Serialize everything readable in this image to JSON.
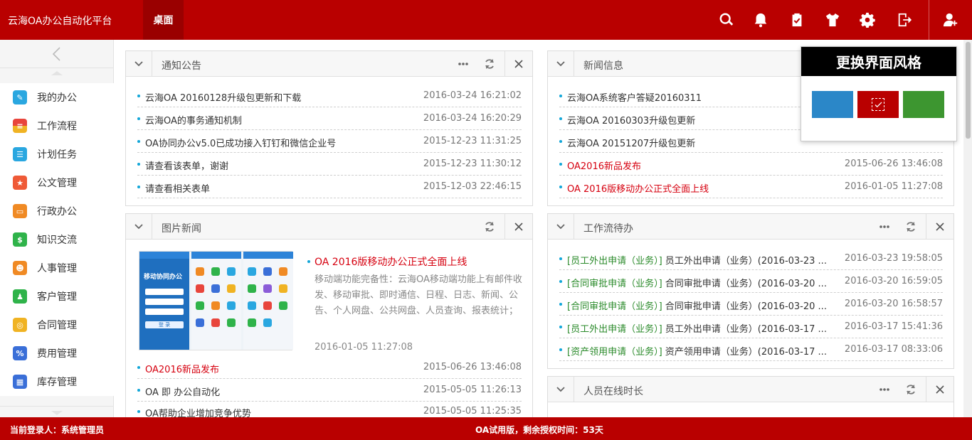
{
  "header": {
    "brand": "云海OA办公自动化平台",
    "active_tab": "桌面",
    "tools": [
      {
        "name": "search-icon"
      },
      {
        "name": "bell-icon"
      },
      {
        "name": "clipboard-check-icon"
      },
      {
        "name": "tshirt-icon"
      },
      {
        "name": "gear-icon"
      },
      {
        "name": "logout-icon"
      },
      {
        "name": "user-switch-icon"
      }
    ]
  },
  "sidebar": {
    "items": [
      {
        "label": "我的办公",
        "color": "#2aa7e0"
      },
      {
        "label": "工作流程",
        "color": "#e8453c"
      },
      {
        "label": "计划任务",
        "color": "#2aa7e0"
      },
      {
        "label": "公文管理",
        "color": "#ef5a37"
      },
      {
        "label": "行政办公",
        "color": "#f08a24"
      },
      {
        "label": "知识交流",
        "color": "#2fb34a"
      },
      {
        "label": "人事管理",
        "color": "#f08a24"
      },
      {
        "label": "客户管理",
        "color": "#2fb34a"
      },
      {
        "label": "合同管理",
        "color": "#f0b323"
      },
      {
        "label": "费用管理",
        "color": "#3a6fd8"
      },
      {
        "label": "库存管理",
        "color": "#3a6fd8"
      }
    ]
  },
  "notice": {
    "title": "通知公告",
    "rows": [
      {
        "text": "云海OA 20160128升级包更新和下载",
        "date": "2016-03-24 16:21:02"
      },
      {
        "text": "云海OA的事务通知机制",
        "date": "2016-03-24 16:20:29"
      },
      {
        "text": "OA协同办公v5.0已成功接入钉钉和微信企业号",
        "date": "2015-12-23 11:31:25"
      },
      {
        "text": "请查看该表单，谢谢",
        "date": "2015-12-23 11:30:12"
      },
      {
        "text": "请查看相关表单",
        "date": "2015-12-03 22:46:15"
      }
    ]
  },
  "news": {
    "title": "新闻信息",
    "rows": [
      {
        "text": "云海OA系统客户答疑20160311",
        "date": ""
      },
      {
        "text": "云海OA 20160303升级包更新",
        "date": ""
      },
      {
        "text": "云海OA 20151207升级包更新",
        "date": ""
      },
      {
        "text": "OA2016新品发布",
        "date": "2015-06-26 13:46:08"
      },
      {
        "text": "OA 2016版移动办公正式全面上线",
        "date": "2016-01-05 11:27:08"
      }
    ]
  },
  "picnews": {
    "title": "图片新闻",
    "image_caption": "移动协同办公",
    "image_button": "登 录",
    "headline": "OA 2016版移动办公正式全面上线",
    "desc": "移动端功能完备性：云海OA移动端功能上有邮件收发、移动审批、即时通信、日程、日志、新闻、公告、个人网盘、公共网盘、人员查询、报表统计；并且新增通讯录、考勤定位打卡、公文办理、消息聊天、快速扩",
    "date": "2016-01-05 11:27:08",
    "rows": [
      {
        "text": "OA2016新品发布",
        "date": "2015-06-26 13:46:08"
      },
      {
        "text": "OA 即 办公自动化",
        "date": "2015-05-05 11:26:13"
      },
      {
        "text": "OA帮助企业增加竞争优势",
        "date": "2015-05-05 11:25:35"
      }
    ]
  },
  "workflow": {
    "title": "工作流待办",
    "rows": [
      {
        "tag": "[员工外出申请（业务）]",
        "text": "员工外出申请（业务）(2016-03-23 ...",
        "date": "2016-03-23 19:58:05"
      },
      {
        "tag": "[合同审批申请（业务）]",
        "text": "合同审批申请（业务）(2016-03-20 ...",
        "date": "2016-03-20 16:59:05"
      },
      {
        "tag": "[合同审批申请（业务）]",
        "text": "合同审批申请（业务）(2016-03-20 ...",
        "date": "2016-03-20 16:58:57"
      },
      {
        "tag": "[员工外出申请（业务）]",
        "text": "员工外出申请（业务）(2016-03-17 ...",
        "date": "2016-03-17 15:41:36"
      },
      {
        "tag": "[资产领用申请（业务）]",
        "text": "资产领用申请（业务）(2016-03-17 ...",
        "date": "2016-03-17 08:33:06"
      }
    ]
  },
  "online": {
    "title": "人员在线时长"
  },
  "theme": {
    "title": "更换界面风格",
    "swatches": [
      {
        "color": "#2b87c8",
        "selected": false
      },
      {
        "color": "#b90000",
        "selected": true
      },
      {
        "color": "#3d9630",
        "selected": false
      }
    ]
  },
  "status": {
    "user": "当前登录人：系统管理员",
    "license": "OA试用版，剩余授权时间：53天"
  }
}
